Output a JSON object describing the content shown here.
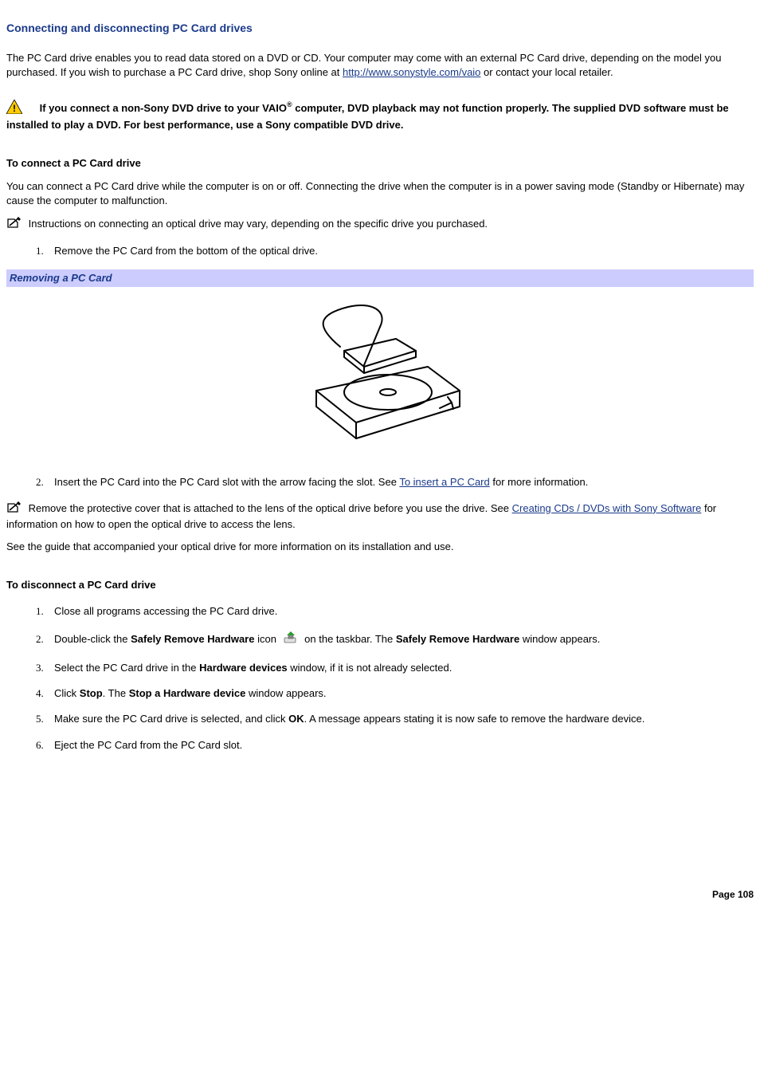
{
  "title": "Connecting and disconnecting PC Card drives",
  "intro_p1_a": "The PC Card drive enables you to read data stored on a DVD or CD. Your computer may come with an external PC Card drive, depending on the model you purchased. If you wish to purchase a PC Card drive, shop Sony online at ",
  "intro_link": "http://www.sonystyle.com/vaio",
  "intro_p1_b": " or contact your local retailer.",
  "warning_a": "If you connect a non-Sony DVD drive to your VAIO",
  "warning_reg": "®",
  "warning_b": " computer, DVD playback may not function properly. The supplied DVD software must be installed to play a DVD. For best performance, use a Sony compatible DVD drive.",
  "connect_heading": "To connect a PC Card drive",
  "connect_p": "You can connect a PC Card drive while the computer is on or off. Connecting the drive when the computer is in a power saving mode (Standby or Hibernate) may cause the computer to malfunction.",
  "connect_note": " Instructions on connecting an optical drive may vary, depending on the specific drive you purchased.",
  "connect_steps": {
    "s1": "Remove the PC Card from the bottom of the optical drive.",
    "s2_a": "Insert the PC Card into the PC Card slot with the arrow facing the slot. See ",
    "s2_link": "To insert a PC Card",
    "s2_b": " for more information."
  },
  "figure_caption": "Removing a PC Card",
  "lens_note_a": " Remove the protective cover that is attached to the lens of the optical drive before you use the drive. See ",
  "lens_link": "Creating CDs / DVDs with Sony Software",
  "lens_note_b": " for information on how to open the optical drive to access the lens.",
  "see_guide": "See the guide that accompanied your optical drive for more information on its installation and use.",
  "disconnect_heading": "To disconnect a PC Card drive",
  "disconnect_steps": {
    "s1": "Close all programs accessing the PC Card drive.",
    "s2_a": "Double-click the ",
    "s2_b": "Safely Remove Hardware",
    "s2_c": " icon ",
    "s2_d": " on the taskbar. The ",
    "s2_e": "Safely Remove Hardware",
    "s2_f": " window appears.",
    "s3_a": "Select the PC Card drive in the ",
    "s3_b": "Hardware devices",
    "s3_c": " window, if it is not already selected.",
    "s4_a": "Click ",
    "s4_b": "Stop",
    "s4_c": ". The ",
    "s4_d": "Stop a Hardware device",
    "s4_e": " window appears.",
    "s5_a": "Make sure the PC Card drive is selected, and click ",
    "s5_b": "OK",
    "s5_c": ". A message appears stating it is now safe to remove the hardware device.",
    "s6": "Eject the PC Card from the PC Card slot."
  },
  "page_number": "Page 108"
}
